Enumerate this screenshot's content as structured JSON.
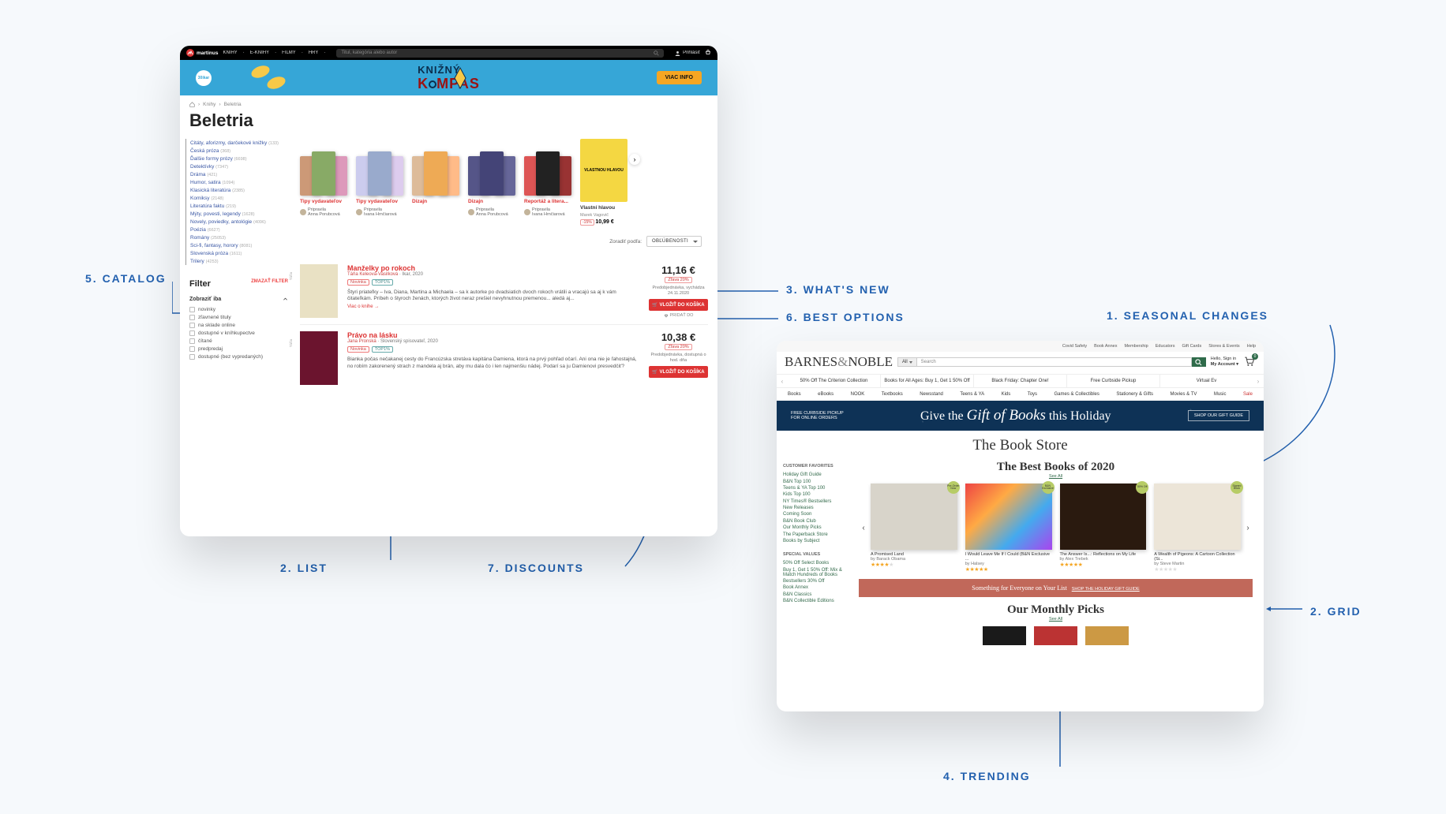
{
  "annotations": {
    "catalog": "5. Catalog",
    "list": "2. List",
    "discounts": "7. Discounts",
    "whatsnew": "3. What's new",
    "bestoptions": "6. Best options",
    "seasonal": "1. Seasonal changes",
    "grid": "2. Grid",
    "trending": "4. Trending"
  },
  "winA": {
    "brand": "martinus",
    "nav": [
      "KNIHY",
      "E-KNIHY",
      "FILMY",
      "HRY"
    ],
    "searchPlaceholder": "Titul, kategória alebo autor",
    "signin": "Prihlásiť",
    "banner": {
      "title_a": "KNIŽNÝ",
      "title_b": "K",
      "title_c": "MPAS",
      "cta": "VIAC INFO",
      "logo": "ikar"
    },
    "crumbs": [
      "Knihy",
      "Beletria"
    ],
    "pageTitle": "Beletria",
    "categories": [
      {
        "label": "Citáty, aforizmy, darčekové knižky",
        "cnt": "(133)"
      },
      {
        "label": "Česká próza",
        "cnt": "(368)"
      },
      {
        "label": "Ďalšie formy prózy",
        "cnt": "(6698)"
      },
      {
        "label": "Detektívky",
        "cnt": "(7347)"
      },
      {
        "label": "Dráma",
        "cnt": "(421)"
      },
      {
        "label": "Humor, satira",
        "cnt": "(1094)"
      },
      {
        "label": "Klasická literatúra",
        "cnt": "(2385)"
      },
      {
        "label": "Komiksy",
        "cnt": "(2148)"
      },
      {
        "label": "Literatúra faktu",
        "cnt": "(219)"
      },
      {
        "label": "Mýty, povesti, legendy",
        "cnt": "(1628)"
      },
      {
        "label": "Novely, poviedky, antológie",
        "cnt": "(4096)"
      },
      {
        "label": "Poézia",
        "cnt": "(6627)"
      },
      {
        "label": "Romány",
        "cnt": "(25053)"
      },
      {
        "label": "Sci-fi, fantasy, horory",
        "cnt": "(8081)"
      },
      {
        "label": "Slovenská próza",
        "cnt": "(1611)"
      },
      {
        "label": "Trilery",
        "cnt": "(4253)"
      }
    ],
    "filterTitle": "Filter",
    "filterReset": "ZMAZAŤ FILTER",
    "filterSub": "Zobraziť iba",
    "filters": [
      "novinky",
      "zľavnené tituly",
      "na sklade online",
      "dostupné v kníhkupectve",
      "čítané",
      "predpredaj",
      "dostupné (bez vypredaných)"
    ],
    "collections": [
      {
        "t": "Tipy vydavateľov",
        "a": [
          "Anna Porubcová"
        ]
      },
      {
        "t": "Tipy vydavateľov",
        "a": [
          "Ivana Hrnčiarová"
        ]
      },
      {
        "t": "Dizajn",
        "a": [
          ""
        ]
      },
      {
        "t": "Dizajn",
        "a": [
          "Anna Porubcová"
        ]
      },
      {
        "t": "Reportáž a litera...",
        "a": [
          "Ivana Hrnčiarová"
        ]
      }
    ],
    "featured": {
      "line1": "VLASTNOU HLAVOU",
      "disc": "-15%",
      "price": "10,99 €",
      "t": "Vlastní hlavou",
      "sub": "Marek Vagovič"
    },
    "sortLabel": "Zoradiť podľa:",
    "sortValue": "OBĽÚBENOSTI",
    "items": [
      {
        "title": "Manželky po rokoch",
        "author": "Táňa Keleová-Vasilková",
        "pub": "· Ikar, 2020",
        "tags": [
          {
            "c": "nov",
            "t": "Novinka"
          },
          {
            "c": "",
            "t": "TOP1%"
          }
        ],
        "desc": "Štyri priateľky – Iva, Diana, Martina a Michaela – sa k autorke po dvadsiatich dvoch rokoch vrátili a vracajú sa aj k vám čitateľkám. Príbeh o štyroch ženách, ktorých život neraz prešiel nevyhnutnou premenou... aledá aj...",
        "more": "Viac o knihe →",
        "price": "11,16 €",
        "disc": "Zľava 20%",
        "preorder": "Predobjednávka, vychádza 24.11.2020",
        "btn": "VLOŽIŤ DO KOŠÍKA",
        "fav": "PRIDAŤ DO"
      },
      {
        "title": "Právo na lásku",
        "author": "Jana Pronská",
        "pub": "· Slovenský spisovateľ, 2020",
        "tags": [
          {
            "c": "nov",
            "t": "Novinka"
          },
          {
            "c": "",
            "t": "TOP1%"
          }
        ],
        "desc": "Bianka počas nečakanej cesty do Francúzska stretáva kapitána Damiena, ktorá na prvý pohľad očarí. Ani ona nie je ľahostajná, no robím zakorenený strach z mandela aj brán, aby mu dala čo i len najmenšiu nádej. Podarí sa ju Damienovi presvedčiť?",
        "price": "10,38 €",
        "disc": "Zľava 20%",
        "preorder": "Predobjednávka, dostupná o hod. dňa",
        "btn": "VLOŽIŤ DO KOŠÍKA"
      }
    ]
  },
  "winB": {
    "toputil": [
      "Covid Safety",
      "Book Annex",
      "Membership",
      "Educators",
      "Gift Cards",
      "Stores & Events",
      "Help"
    ],
    "brand_a": "BARNES",
    "brand_b": "&",
    "brand_c": "NOBLE",
    "searchCat": "All",
    "searchPh": "Search",
    "acct_hello": "Hello, Sign in",
    "acct_line": "My Account ▾",
    "cart": "0",
    "promos": [
      "50% Off The Criterion Collection",
      "Books for All Ages: Buy 1, Get 1 50% Off",
      "Black Friday: Chapter One!",
      "Free Curbside Pickup",
      "Virtual Ev"
    ],
    "depts": [
      "Books",
      "eBooks",
      "NOOK",
      "Textbooks",
      "Newsstand",
      "Teens & YA",
      "Kids",
      "Toys",
      "Games & Collectibles",
      "Stationery & Gifts",
      "Movies & TV",
      "Music",
      "Sale"
    ],
    "giftL1": "FREE CURBSIDE PICKUP",
    "giftL2": "FOR ONLINE ORDERS",
    "giftC": "Give the Gift of Books this Holiday",
    "giftR": "SHOP OUR GIFT GUIDE",
    "storeTitle": "The Book Store",
    "sideFav": "CUSTOMER FAVORITES",
    "favLinks": [
      "Holiday Gift Guide",
      "B&N Top 100",
      "Teens & YA Top 100",
      "Kids Top 100",
      "NY Times® Bestsellers",
      "New Releases",
      "Coming Soon",
      "B&N Book Club",
      "Our Monthly Picks",
      "The Paperback Store",
      "Books by Subject"
    ],
    "sideSpec": "SPECIAL VALUES",
    "specLinks": [
      "50% Off Select Books",
      "Buy 1, Get 1 50% Off: Mix & Match Hundreds of Books",
      "Bestsellers 30% Off",
      "Book Annex",
      "B&N Classics",
      "B&N Collectible Editions"
    ],
    "secBest": "The Best Books of 2020",
    "seeAll": "See All",
    "books": [
      {
        "t": "A Promised Land",
        "a": "by Barack Obama",
        "s": 4,
        "badge": "Pre-Order Now"
      },
      {
        "t": "I Would Leave Me If I Could (B&N Exclusive ...",
        "a": "by Halsey",
        "s": 5,
        "badge": "B&N Exclusive"
      },
      {
        "t": "The Answer Is...: Reflections on My Life",
        "a": "by Alex Trebek",
        "s": 5,
        "badge": "50% Off"
      },
      {
        "t": "A Wealth of Pigeons: A Cartoon Collection (Si...",
        "a": "by Steve Martin",
        "s": 0,
        "badge": "Signed Book"
      }
    ],
    "ctaBanner": "Something for Everyone on Your List",
    "ctaShop": "SHOP THE HOLIDAY GIFT GUIDE",
    "secMonthly": "Our Monthly Picks"
  }
}
